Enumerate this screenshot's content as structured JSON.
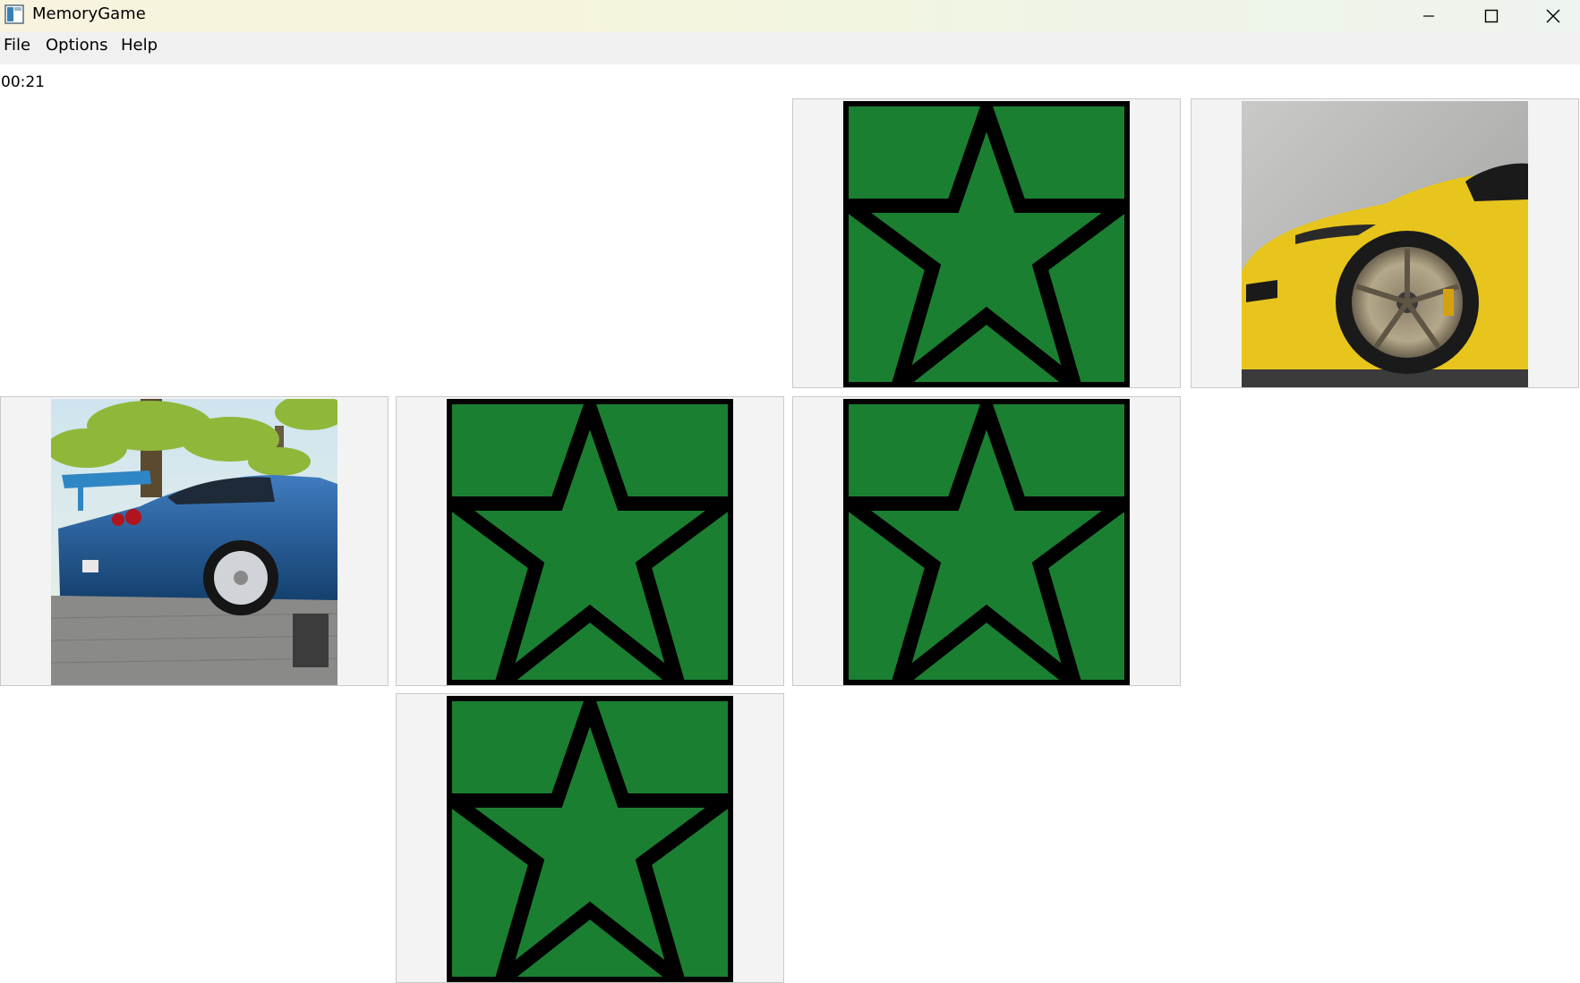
{
  "window": {
    "title": "MemoryGame",
    "titlebar_gradient": [
      "#f7f3de",
      "#eef4ee"
    ],
    "controls": [
      "minimize-icon",
      "maximize-icon",
      "close-icon"
    ]
  },
  "menu": {
    "file": "File",
    "options": "Options",
    "help": "Help"
  },
  "timer": "00:21",
  "board": {
    "rows": 3,
    "columns": 4,
    "card_back_color": "#1b7f32",
    "card_back_icon": "star-icon",
    "cards": [
      {
        "row": 1,
        "col": 3,
        "state": "face-down",
        "face": "star-icon"
      },
      {
        "row": 1,
        "col": 4,
        "state": "face-up",
        "face": "yellow-sports-car-image"
      },
      {
        "row": 2,
        "col": 1,
        "state": "face-up",
        "face": "blue-skyline-car-image"
      },
      {
        "row": 2,
        "col": 2,
        "state": "face-down",
        "face": "star-icon"
      },
      {
        "row": 2,
        "col": 3,
        "state": "face-down",
        "face": "star-icon"
      },
      {
        "row": 3,
        "col": 2,
        "state": "face-down",
        "face": "star-icon"
      }
    ]
  }
}
